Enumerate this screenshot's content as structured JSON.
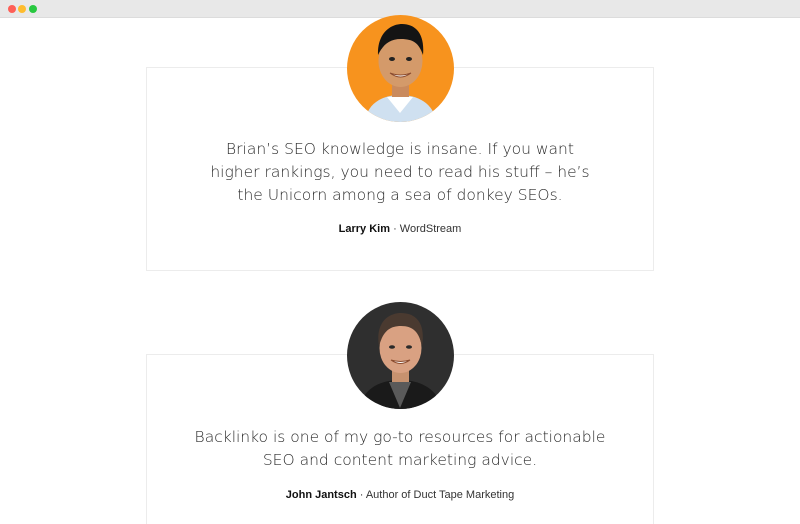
{
  "window": {
    "controls": [
      "close",
      "minimize",
      "maximize"
    ]
  },
  "testimonials": [
    {
      "quote": "Brian’s SEO knowledge is insane. If you want higher rankings, you need to read his stuff – he’s the Unicorn among a sea of donkey SEOs.",
      "name": "Larry Kim",
      "separator": " · ",
      "company": "WordStream",
      "avatar_bg": "#f7931e"
    },
    {
      "quote": "Backlinko is one of my go-to resources for actionable SEO and content marketing advice.",
      "name": "John Jantsch",
      "separator": " · ",
      "company": "Author of Duct Tape Marketing",
      "avatar_bg": "#2f2f2f"
    }
  ]
}
